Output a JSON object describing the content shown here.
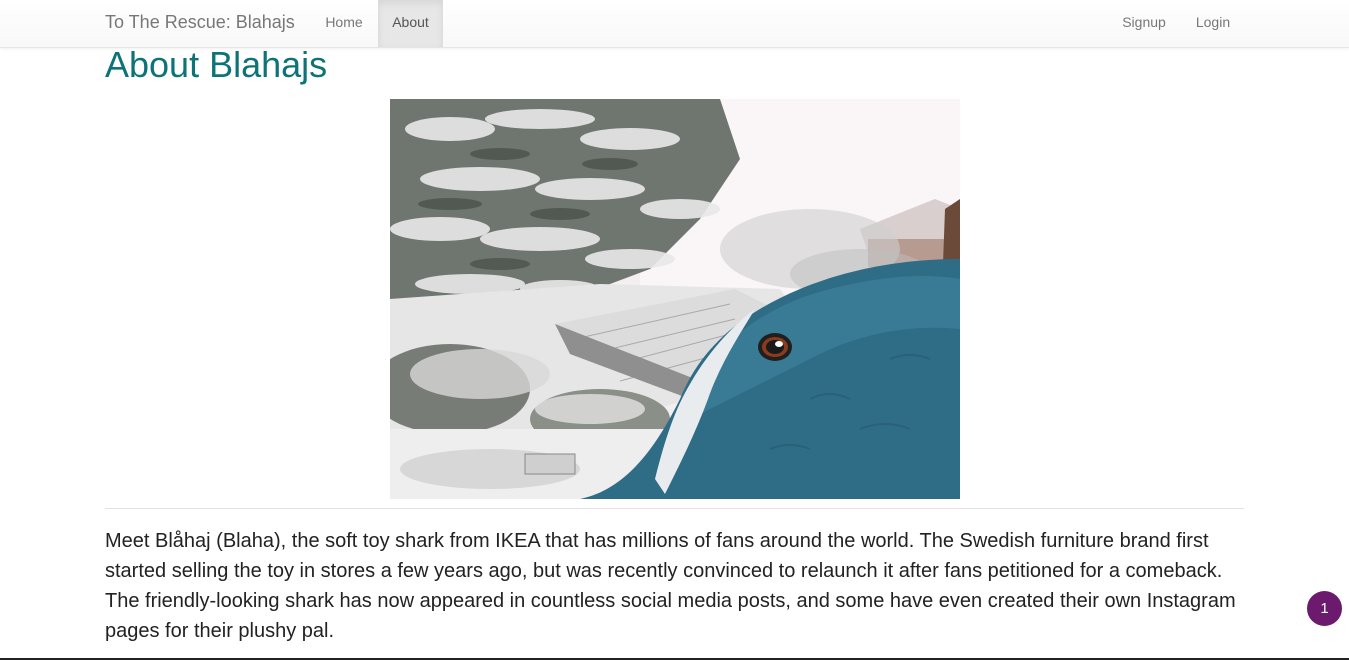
{
  "navbar": {
    "brand": "To The Rescue: Blahajs",
    "items": [
      {
        "label": "Home",
        "active": false
      },
      {
        "label": "About",
        "active": true
      }
    ],
    "right_items": [
      {
        "label": "Signup"
      },
      {
        "label": "Login"
      }
    ]
  },
  "page": {
    "title": "About Blahajs",
    "photo_icon": "blahaj-snow-photo",
    "intro": "Meet Blåhaj (Blaha), the soft toy shark from IKEA that has millions of fans around the world. The Swedish furniture brand first started selling the toy in stores a few years ago, but was recently convinced to relaunch it after fans petitioned for a comeback. The friendly-looking shark has now appeared in countless social media posts, and some have even created their own Instagram pages for their plushy pal."
  },
  "notification_badge": {
    "count": "1",
    "color": "#6b1a6e"
  },
  "colors": {
    "title": "#0d7377",
    "navbar_bg": "#f8f8f8",
    "active_tab_bg": "#e7e7e7"
  }
}
